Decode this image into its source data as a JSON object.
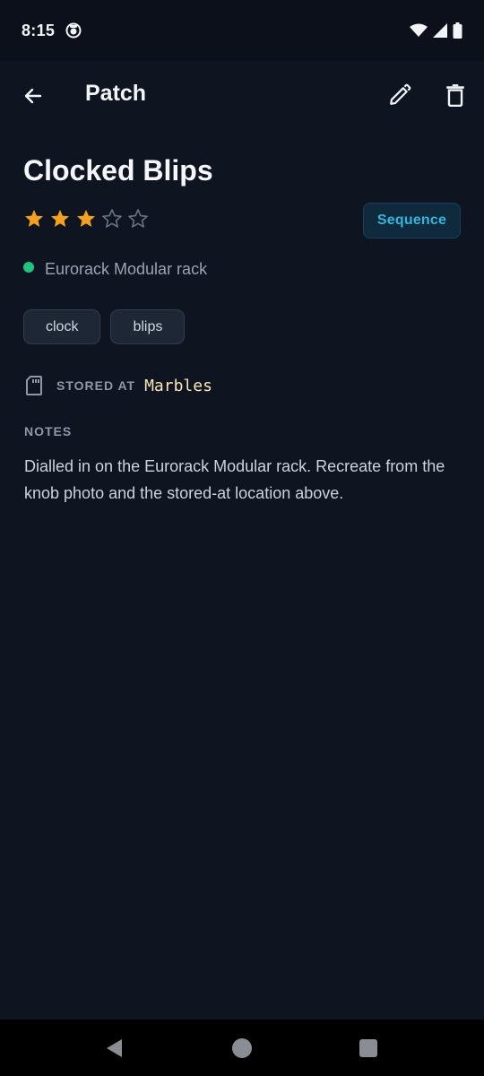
{
  "status_bar": {
    "time": "8:15",
    "icons": [
      "app-notification-icon",
      "wifi-icon",
      "signal-icon",
      "battery-icon"
    ]
  },
  "app_bar": {
    "title": "Patch",
    "actions": [
      "back-arrow-icon",
      "edit-pencil-icon",
      "delete-trash-icon"
    ]
  },
  "patch": {
    "name": "Clocked Blips",
    "rating": 3,
    "rating_max": 5,
    "category": "Sequence",
    "rack": "Eurorack Modular rack",
    "tags": [
      "clock",
      "blips"
    ],
    "stored_at_label": "STORED AT",
    "stored_at_value": "Marbles",
    "notes_heading": "NOTES",
    "notes": "Dialled in on the Eurorack Modular rack. Recreate from the knob photo and the stored-at location above."
  },
  "colors": {
    "background": "#0e1420",
    "star_filled": "#f4a21c",
    "star_empty": "#6b7484",
    "accent": "#33b6dd",
    "rack_dot": "#21c47e",
    "stored_value": "#f6e7b5"
  },
  "nav_bar": {
    "buttons": [
      "nav-back-icon",
      "nav-home-icon",
      "nav-recents-icon"
    ]
  }
}
